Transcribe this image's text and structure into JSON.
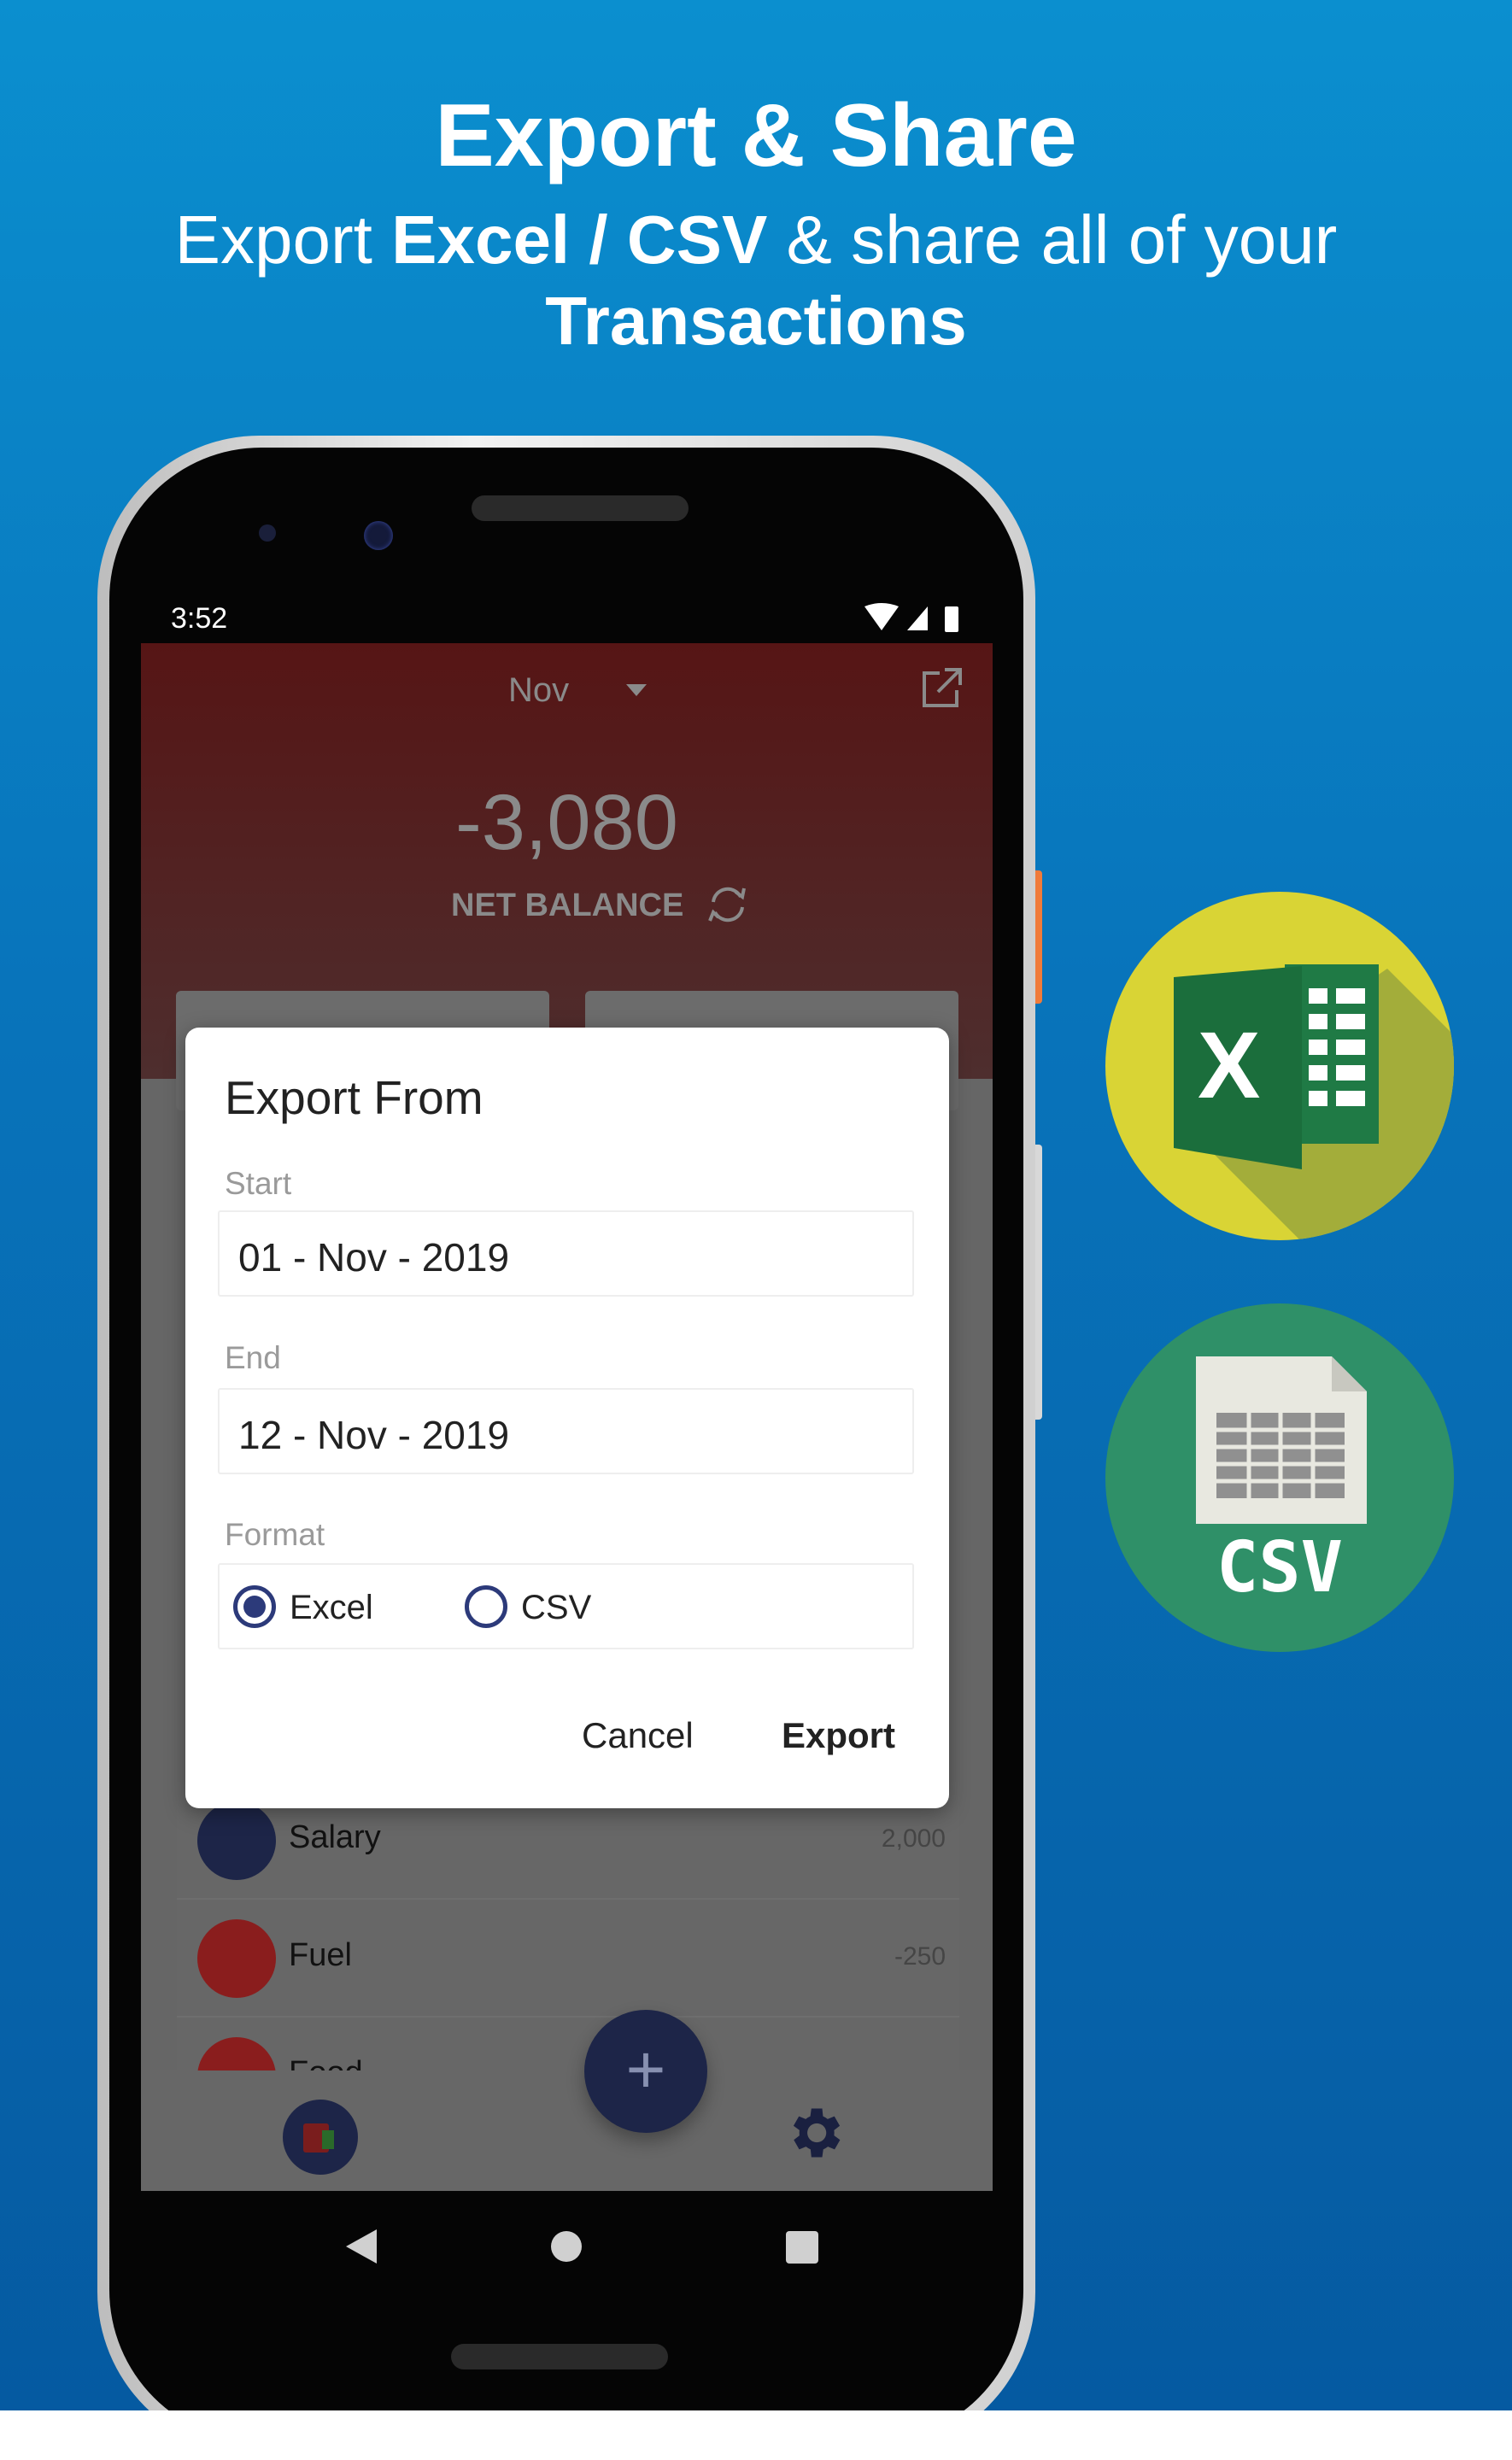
{
  "hero": {
    "title": "Export & Share",
    "subtitle_pre": "Export ",
    "subtitle_bold": "Excel / CSV",
    "subtitle_post": " & share all of your",
    "subtitle_line2": "Transactions"
  },
  "status_bar": {
    "time": "3:52"
  },
  "header": {
    "month": "Nov",
    "net_balance": "-3,080",
    "net_balance_label": "NET BALANCE"
  },
  "transactions": [
    {
      "name": "Salary",
      "amount": "2,000",
      "color": "#1d2548"
    },
    {
      "name": "Fuel",
      "amount": "-250",
      "color": "#8a1d1d"
    },
    {
      "name": "Food",
      "amount": "",
      "color": "#8a1d1d"
    }
  ],
  "dialog": {
    "title": "Export From",
    "start_label": "Start",
    "start_value": "01 - Nov - 2019",
    "end_label": "End",
    "end_value": "12 - Nov - 2019",
    "format_label": "Format",
    "format_options": [
      "Excel",
      "CSV"
    ],
    "selected_format": "Excel",
    "cancel": "Cancel",
    "export": "Export"
  },
  "badges": {
    "excel_letter": "X",
    "csv_label": "CSV"
  },
  "colors": {
    "accent": "#2c3a7a",
    "header_red": "#561515",
    "excel_bg": "#d9d435",
    "csv_bg": "#2f9068"
  }
}
